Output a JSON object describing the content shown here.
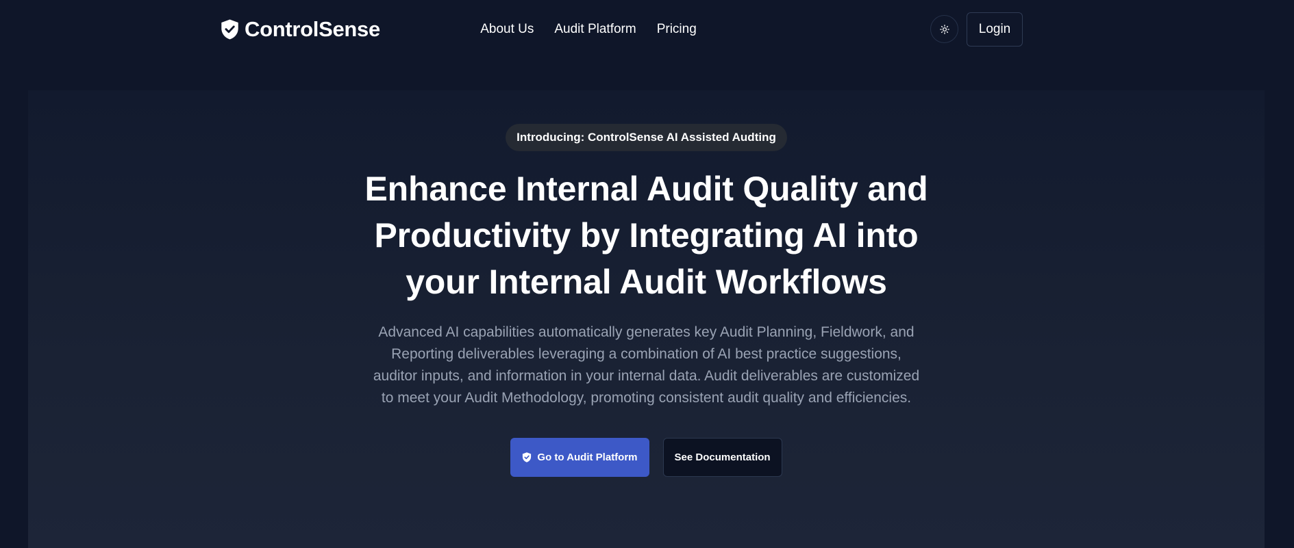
{
  "colors": {
    "page_background": "#0f1629",
    "hero_background": "#1a2234",
    "primary_button": "#3d59c7",
    "secondary_button": "#0c1222",
    "pill_background": "#252a33",
    "muted_text": "#9aa3b4"
  },
  "header": {
    "brand": {
      "name": "ControlSense",
      "icon": "shield-check-icon"
    },
    "nav": [
      {
        "label": "About Us"
      },
      {
        "label": "Audit Platform"
      },
      {
        "label": "Pricing"
      }
    ],
    "theme_toggle_icon": "sun-icon",
    "login_label": "Login"
  },
  "hero": {
    "announcement": "Introducing: ControlSense AI Assisted Audting",
    "title_lines": [
      "Enhance Internal Audit Quality and",
      "Productivity by Integrating AI into",
      "your Internal Audit Workflows"
    ],
    "description": "Advanced AI capabilities automatically generates key Audit Planning, Fieldwork, and Reporting deliverables leveraging a combination of AI best practice suggestions, auditor inputs, and information in your internal data. Audit deliverables are customized to meet your Audit Methodology, promoting consistent audit quality and efficiencies.",
    "primary_cta": {
      "label": "Go to Audit Platform",
      "icon": "shield-check-icon"
    },
    "secondary_cta": {
      "label": "See Documentation"
    }
  }
}
